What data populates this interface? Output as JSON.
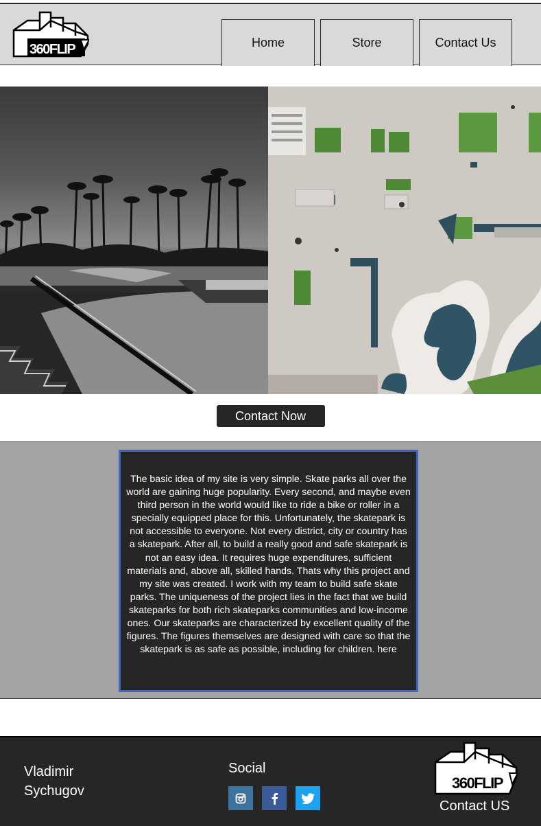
{
  "brand": {
    "logo_text": "360FLIP"
  },
  "nav": {
    "items": [
      {
        "label": "Home"
      },
      {
        "label": "Store"
      },
      {
        "label": "Contact Us"
      }
    ]
  },
  "hero": {
    "cta_label": "Contact Now"
  },
  "about": {
    "text": "The basic idea of my site is very simple. Skate parks all over the world are gaining huge popularity. Every second, and maybe even third person in the world would like to ride a bike or roller in a specially equipped place for this. Unfortunately, the skatepark is not accessible to everyone. Not every district, city or country has a skatepark. After all, to build a really good and safe skatepark is not an easy idea. It requires huge expenditures, sufficient materials and, above all, skilled hands. Thats why this project and my site was created. I work with my team to build safe skate parks. The uniqueness of the project lies in the fact that we build skateparks for both rich skateparks communities and low-income ones. Our skateparks are characterized by excellent quality of the figures. The figures themselves are designed with care so that the skatepark is as safe as possible, including for children. here"
  },
  "footer": {
    "name_line1": "Vladimir",
    "name_line2": "Sychugov",
    "social_title": "Social",
    "socials": [
      {
        "icon": "instagram-icon"
      },
      {
        "icon": "facebook-icon"
      },
      {
        "icon": "twitter-icon"
      }
    ],
    "contact_label": "Contact US"
  },
  "colors": {
    "header_bg": "#d9d9d9",
    "dark": "#262626",
    "about_bg": "#a3a3a3",
    "about_border": "#3b63c8",
    "instagram": "#3e739f",
    "facebook": "#3d5a98",
    "twitter": "#1da1f2"
  }
}
